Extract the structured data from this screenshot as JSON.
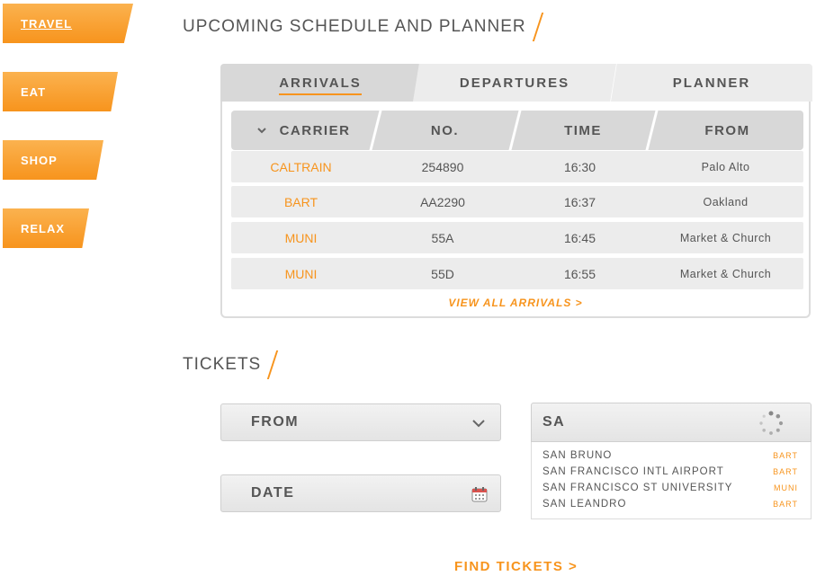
{
  "colors": {
    "accent": "#f7941d",
    "tab_active": "#d8d8d8",
    "tab_inactive": "#ececec",
    "row": "#ececec"
  },
  "nav": [
    {
      "label": "TRAVEL",
      "active": true
    },
    {
      "label": "EAT"
    },
    {
      "label": "SHOP"
    },
    {
      "label": "RELAX"
    }
  ],
  "schedule": {
    "title": "UPCOMING SCHEDULE AND PLANNER",
    "tabs": [
      "ARRIVALS",
      "DEPARTURES",
      "PLANNER"
    ],
    "columns": [
      "CARRIER",
      "NO.",
      "TIME",
      "FROM"
    ],
    "rows": [
      {
        "carrier": "CALTRAIN",
        "no": "254890",
        "time": "16:30",
        "from": "Palo Alto"
      },
      {
        "carrier": "BART",
        "no": "AA2290",
        "time": "16:37",
        "from": "Oakland"
      },
      {
        "carrier": "MUNI",
        "no": "55A",
        "time": "16:45",
        "from": "Market & Church"
      },
      {
        "carrier": "MUNI",
        "no": "55D",
        "time": "16:55",
        "from": "Market & Church"
      }
    ],
    "view_all": "VIEW ALL ARRIVALS >"
  },
  "tickets": {
    "title": "TICKETS",
    "from_label": "FROM",
    "date_label": "DATE",
    "search_value": "SA",
    "suggestions": [
      {
        "name": "SAN BRUNO",
        "tag": "BART"
      },
      {
        "name": "SAN FRANCISCO INTL AIRPORT",
        "tag": "BART"
      },
      {
        "name": "SAN FRANCISCO ST UNIVERSITY",
        "tag": "MUNI"
      },
      {
        "name": "SAN LEANDRO",
        "tag": "BART"
      }
    ],
    "find_label": "FIND TICKETS >"
  }
}
